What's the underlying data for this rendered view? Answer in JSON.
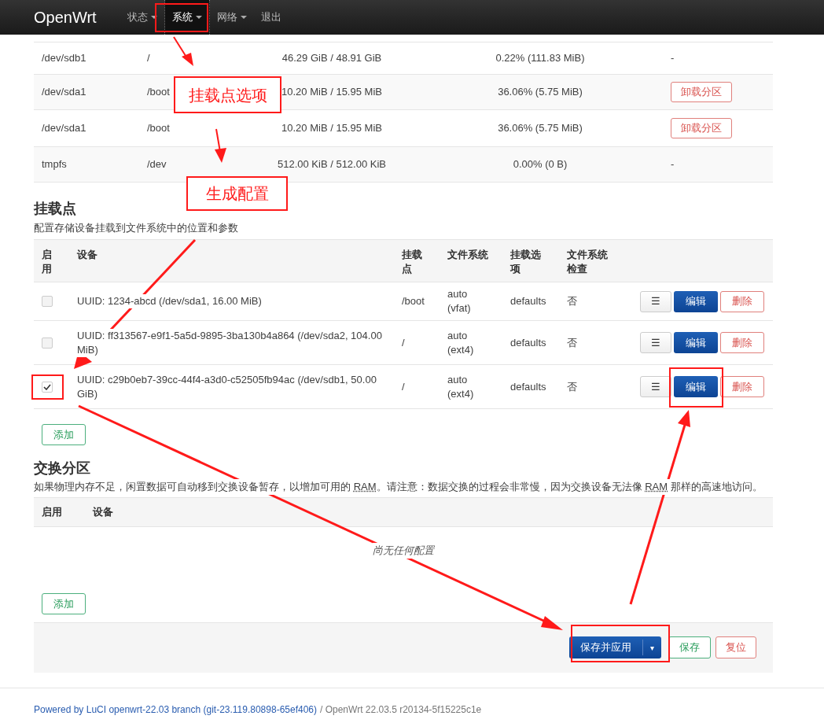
{
  "navbar": {
    "brand": "OpenWrt",
    "menu": [
      {
        "label": "状态",
        "dropdown": true,
        "selected": false
      },
      {
        "label": "系统",
        "dropdown": true,
        "selected": true
      },
      {
        "label": "网络",
        "dropdown": true,
        "selected": false
      },
      {
        "label": "退出",
        "dropdown": false,
        "selected": false
      }
    ]
  },
  "mounted_table": {
    "rows": [
      {
        "device": "/dev/sdb1",
        "mount": "/",
        "size": "46.29 GiB / 48.91 GiB",
        "usage": "0.22% (111.83 MiB)",
        "action": {
          "kind": "text",
          "label": "-"
        }
      },
      {
        "device": "/dev/sda1",
        "mount": "/boot",
        "size": "10.20 MiB / 15.95 MiB",
        "usage": "36.06% (5.75 MiB)",
        "action": {
          "kind": "button",
          "label": "卸载分区"
        }
      },
      {
        "device": "/dev/sda1",
        "mount": "/boot",
        "size": "10.20 MiB / 15.95 MiB",
        "usage": "36.06% (5.75 MiB)",
        "action": {
          "kind": "button",
          "label": "卸载分区"
        }
      },
      {
        "device": "tmpfs",
        "mount": "/dev",
        "size": "512.00 KiB / 512.00 KiB",
        "usage": "0.00% (0 B)",
        "action": {
          "kind": "text",
          "label": "-"
        }
      }
    ]
  },
  "mount_points": {
    "title": "挂载点",
    "description": "配置存储设备挂载到文件系统中的位置和参数",
    "columns": [
      "启用",
      "设备",
      "挂载点",
      "文件系统",
      "挂载选项",
      "文件系统检查"
    ],
    "rows": [
      {
        "enabled": false,
        "device": "UUID: 1234-abcd (/dev/sda1, 16.00 MiB)",
        "mount": "/boot",
        "fs": "auto (vfat)",
        "options": "defaults",
        "check": "否",
        "buttons": {
          "menu": "☰",
          "edit": "编辑",
          "delete": "删除"
        }
      },
      {
        "enabled": false,
        "device": "UUID: ff313567-e9f1-5a5d-9895-3ba130b4a864 (/dev/sda2, 104.00 MiB)",
        "mount": "/",
        "fs": "auto (ext4)",
        "options": "defaults",
        "check": "否",
        "buttons": {
          "menu": "☰",
          "edit": "编辑",
          "delete": "删除"
        }
      },
      {
        "enabled": true,
        "device": "UUID: c29b0eb7-39cc-44f4-a3d0-c52505fb94ac (/dev/sdb1, 50.00 GiB)",
        "mount": "/",
        "fs": "auto (ext4)",
        "options": "defaults",
        "check": "否",
        "buttons": {
          "menu": "☰",
          "edit": "编辑",
          "delete": "删除"
        }
      }
    ],
    "add_button": "添加"
  },
  "swap": {
    "title": "交换分区",
    "description_parts": [
      "如果物理内存不足，闲置数据可自动移到交换设备暂存，以增加可用的 ",
      "RAM",
      "。请注意：数据交换的过程会非常慢，因为交换设备无法像 ",
      "RAM",
      " 那样的高速地访问。"
    ],
    "columns": [
      "启用",
      "设备"
    ],
    "empty_text": "尚无任何配置",
    "add_button": "添加"
  },
  "actions": {
    "save_apply": "保存并应用",
    "dropdown": "▾",
    "save": "保存",
    "reset": "复位"
  },
  "footer": {
    "link": "Powered by LuCI openwrt-22.03 branch (git-23.119.80898-65ef406)",
    "text": "/ OpenWrt 22.03.5 r20134-5f15225c1e"
  },
  "annotations": [
    {
      "kind": "callout",
      "text": "挂载点选项"
    },
    {
      "kind": "callout",
      "text": "生成配置"
    }
  ]
}
